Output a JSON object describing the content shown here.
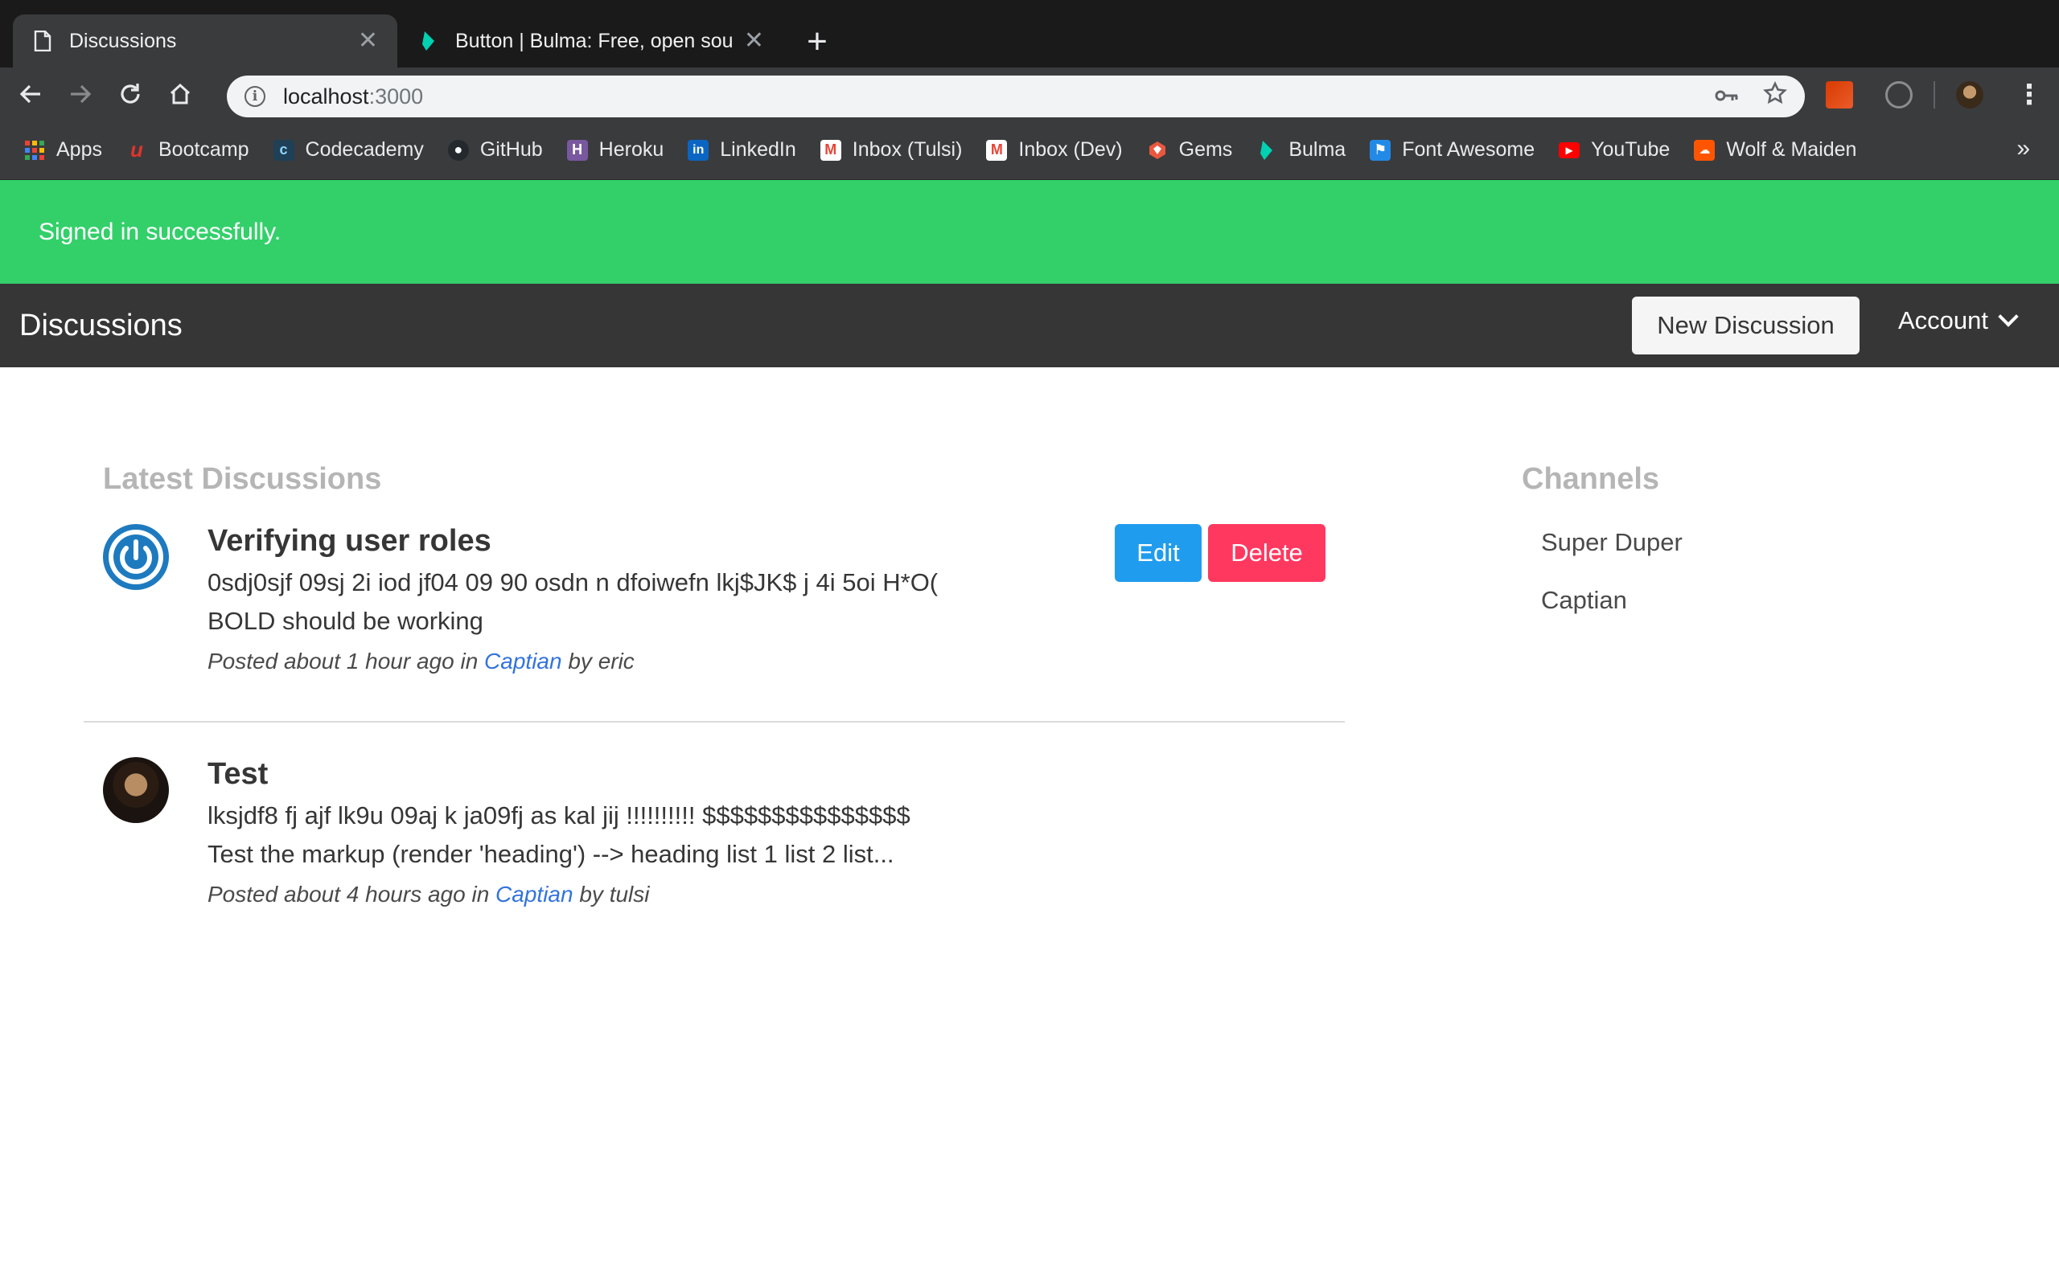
{
  "browser": {
    "tabs": [
      {
        "title": "Discussions",
        "icon": "document-icon",
        "active": true
      },
      {
        "title": "Button | Bulma: Free, open source",
        "icon": "bulma-icon",
        "active": false
      }
    ],
    "url_host": "localhost",
    "url_port": ":3000",
    "bookmarks": [
      {
        "label": "Apps",
        "icon": "apps-grid-icon",
        "color": "#ea4335"
      },
      {
        "label": "Bootcamp",
        "icon": "bootcamp-icon",
        "color": "#e0342c"
      },
      {
        "label": "Codecademy",
        "icon": "codecademy-icon",
        "color": "#1f4056"
      },
      {
        "label": "GitHub",
        "icon": "github-icon",
        "color": "#24292e"
      },
      {
        "label": "Heroku",
        "icon": "heroku-icon",
        "color": "#79589f"
      },
      {
        "label": "LinkedIn",
        "icon": "linkedin-icon",
        "color": "#0a66c2"
      },
      {
        "label": "Inbox (Tulsi)",
        "icon": "gmail-icon",
        "color": "#ea4335"
      },
      {
        "label": "Inbox (Dev)",
        "icon": "gmail-icon",
        "color": "#ea4335"
      },
      {
        "label": "Gems",
        "icon": "gems-icon",
        "color": "#e9573f"
      },
      {
        "label": "Bulma",
        "icon": "bulma-icon",
        "color": "#00d1b2"
      },
      {
        "label": "Font Awesome",
        "icon": "font-awesome-icon",
        "color": "#228ae6"
      },
      {
        "label": "YouTube",
        "icon": "youtube-icon",
        "color": "#ff0000"
      },
      {
        "label": "Wolf & Maiden",
        "icon": "soundcloud-icon",
        "color": "#ff5500"
      }
    ],
    "more_label": "»"
  },
  "notice": "Signed in successfully.",
  "navbar": {
    "brand": "Discussions",
    "new_discussion": "New Discussion",
    "account": "Account"
  },
  "latest": {
    "heading": "Latest Discussions",
    "posts": [
      {
        "title": "Verifying user roles",
        "excerpt_line1": "0sdj0sjf 09sj 2i iod jf04 09 90 osdn n dfoiwefn lkj$JK$ j 4i 5oi H*O(",
        "excerpt_line2": "BOLD should be working",
        "meta_prefix": "Posted about 1 hour ago in ",
        "channel": "Captian",
        "meta_suffix": " by eric",
        "edit_label": "Edit",
        "delete_label": "Delete"
      },
      {
        "title": "Test",
        "excerpt_line1": "lksjdf8 fj ajf lk9u 09aj k ja09fj as kal jij !!!!!!!!!! $$$$$$$$$$$$$$$",
        "excerpt_line2": "Test the markup (render 'heading') --> heading list 1 list 2 list...",
        "meta_prefix": "Posted about 4 hours ago in ",
        "channel": "Captian",
        "meta_suffix": " by tulsi"
      }
    ]
  },
  "channels": {
    "heading": "Channels",
    "items": [
      "Super Duper",
      "Captian"
    ]
  }
}
